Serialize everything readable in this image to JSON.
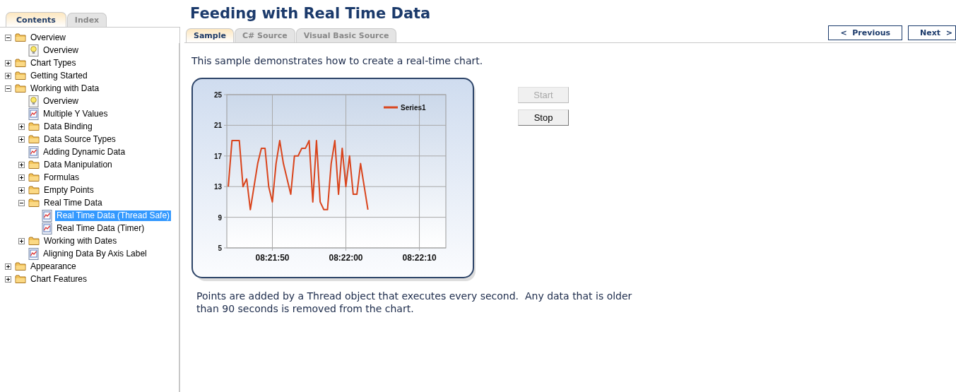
{
  "sidebar": {
    "tabs": [
      {
        "label": "Contents",
        "selected": true
      },
      {
        "label": "Index",
        "selected": false
      }
    ],
    "tree": [
      {
        "label": "Overview",
        "kind": "folder",
        "expanded": true,
        "selected": false,
        "children": [
          {
            "label": "Overview",
            "kind": "tip",
            "selected": false
          }
        ]
      },
      {
        "label": "Chart Types",
        "kind": "folder",
        "expanded": false,
        "selected": false
      },
      {
        "label": "Getting Started",
        "kind": "folder",
        "expanded": false,
        "selected": false
      },
      {
        "label": "Working with Data",
        "kind": "folder",
        "expanded": true,
        "selected": false,
        "children": [
          {
            "label": "Overview",
            "kind": "tip",
            "selected": false
          },
          {
            "label": "Multiple Y Values",
            "kind": "page",
            "selected": false
          },
          {
            "label": "Data Binding",
            "kind": "folder",
            "expanded": false,
            "selected": false
          },
          {
            "label": "Data Source Types",
            "kind": "folder",
            "expanded": false,
            "selected": false
          },
          {
            "label": "Adding Dynamic Data",
            "kind": "page",
            "selected": false
          },
          {
            "label": "Data Manipulation",
            "kind": "folder",
            "expanded": false,
            "selected": false
          },
          {
            "label": "Formulas",
            "kind": "folder",
            "expanded": false,
            "selected": false
          },
          {
            "label": "Empty Points",
            "kind": "folder",
            "expanded": false,
            "selected": false
          },
          {
            "label": "Real Time Data",
            "kind": "folder",
            "expanded": true,
            "selected": false,
            "children": [
              {
                "label": "Real Time Data (Thread Safe)",
                "kind": "page",
                "selected": true
              },
              {
                "label": "Real Time Data (Timer)",
                "kind": "page",
                "selected": false
              }
            ]
          },
          {
            "label": "Working with Dates",
            "kind": "folder",
            "expanded": false,
            "selected": false
          },
          {
            "label": "Aligning Data By Axis Label",
            "kind": "page",
            "selected": false
          }
        ]
      },
      {
        "label": "Appearance",
        "kind": "folder",
        "expanded": false,
        "selected": false
      },
      {
        "label": "Chart Features",
        "kind": "folder",
        "expanded": false,
        "selected": false
      }
    ]
  },
  "page": {
    "title": "Feeding with Real Time Data",
    "tabs": [
      {
        "label": "Sample",
        "selected": true
      },
      {
        "label": "C# Source",
        "selected": false
      },
      {
        "label": "Visual Basic Source",
        "selected": false
      }
    ],
    "nav": [
      {
        "label": "<  Previous"
      },
      {
        "label": "Next  >"
      }
    ],
    "intro": "This sample demonstrates how to create a real-time chart.",
    "chart_data": {
      "type": "line",
      "x": [
        30104,
        30104.5,
        30105,
        30105.5,
        30106,
        30106.5,
        30107,
        30107.5,
        30108,
        30108.5,
        30109,
        30109.5,
        30110,
        30110.5,
        30111,
        30111.5,
        30112,
        30112.5,
        30113,
        30113.5,
        30114,
        30114.5,
        30115,
        30115.5,
        30116,
        30116.5,
        30117,
        30117.5,
        30118,
        30118.5,
        30119,
        30119.5,
        30120,
        30120.5,
        30121,
        30121.5,
        30122,
        30122.5,
        30123
      ],
      "series": [
        {
          "name": "Series1",
          "color": "#d9441c",
          "values": [
            13,
            19,
            19,
            19,
            13,
            14,
            10,
            13,
            16,
            18,
            18,
            13,
            11,
            16,
            19,
            16,
            14,
            12,
            17,
            17,
            18,
            18,
            19,
            11,
            19,
            11,
            10,
            10,
            16,
            19,
            12,
            18,
            13,
            17,
            12,
            12,
            16,
            13,
            10
          ]
        }
      ],
      "xlim": [
        30103.8,
        30133.6
      ],
      "ylim": [
        5,
        25
      ],
      "xticks": [
        {
          "value": 30110,
          "label": "08:21:50"
        },
        {
          "value": 30120,
          "label": "08:22:00"
        },
        {
          "value": 30130,
          "label": "08:22:10"
        }
      ],
      "yticks": [
        5,
        9,
        13,
        17,
        21,
        25
      ],
      "grid": true
    },
    "controls": [
      {
        "label": "Start",
        "disabled": true
      },
      {
        "label": "Stop",
        "disabled": false
      }
    ],
    "description": "Points are added by a Thread object that executes every second.  Any data that is older than 90 seconds is removed from the chart."
  }
}
